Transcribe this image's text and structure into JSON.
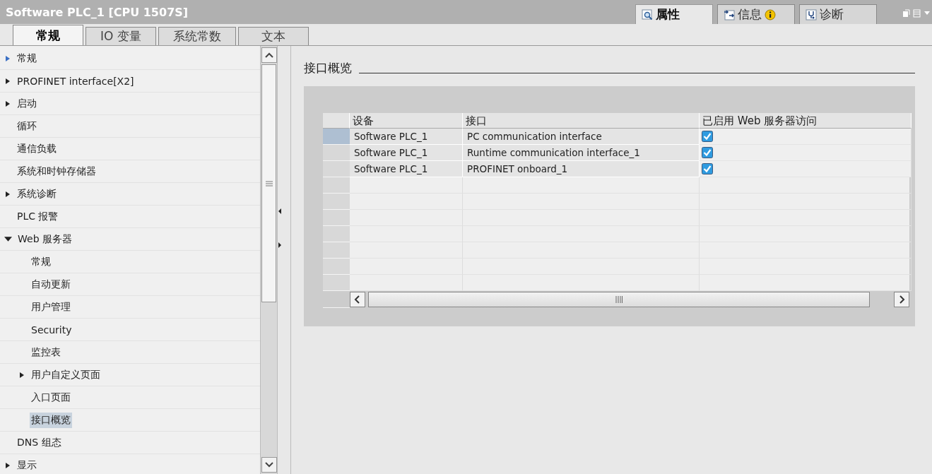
{
  "window": {
    "title": "Software PLC_1 [CPU 1507S]"
  },
  "inspector_tabs": [
    {
      "label": "属性",
      "selected": true,
      "badge": false
    },
    {
      "label": "信息",
      "selected": false,
      "badge": true
    },
    {
      "label": "诊断",
      "selected": false,
      "badge": false
    }
  ],
  "tabs": [
    {
      "label": "常规",
      "selected": true
    },
    {
      "label": "IO 变量",
      "selected": false
    },
    {
      "label": "系统常数",
      "selected": false
    },
    {
      "label": "文本",
      "selected": false
    }
  ],
  "tree": [
    {
      "label": "常规",
      "kind": "folder",
      "expanded": false,
      "selected": false
    },
    {
      "label": "PROFINET interface[X2]",
      "kind": "folder",
      "expanded": false,
      "selected": false
    },
    {
      "label": "启动",
      "kind": "folder",
      "expanded": false,
      "selected": false
    },
    {
      "label": "循环",
      "kind": "leaf",
      "selected": false
    },
    {
      "label": "通信负载",
      "kind": "leaf",
      "selected": false
    },
    {
      "label": "系统和时钟存储器",
      "kind": "leaf",
      "selected": false
    },
    {
      "label": "系统诊断",
      "kind": "folder",
      "expanded": false,
      "selected": false
    },
    {
      "label": "PLC 报警",
      "kind": "leaf",
      "selected": false
    },
    {
      "label": "Web 服务器",
      "kind": "folder",
      "expanded": true,
      "selected": false,
      "children": [
        {
          "label": "常规",
          "kind": "leaf",
          "selected": false
        },
        {
          "label": "自动更新",
          "kind": "leaf",
          "selected": false
        },
        {
          "label": "用户管理",
          "kind": "leaf",
          "selected": false
        },
        {
          "label": "Security",
          "kind": "leaf",
          "selected": false
        },
        {
          "label": "监控表",
          "kind": "leaf",
          "selected": false
        },
        {
          "label": "用户自定义页面",
          "kind": "folder",
          "expanded": false,
          "selected": false
        },
        {
          "label": "入口页面",
          "kind": "leaf",
          "selected": false
        },
        {
          "label": "接口概览",
          "kind": "leaf",
          "selected": true
        }
      ]
    },
    {
      "label": "DNS 组态",
      "kind": "leaf",
      "selected": false
    },
    {
      "label": "显示",
      "kind": "folder",
      "expanded": false,
      "selected": false
    }
  ],
  "section": {
    "title": "接口概览"
  },
  "table": {
    "columns": [
      "设备",
      "接口",
      "已启用 Web 服务器访问"
    ],
    "rows": [
      {
        "device": "Software PLC_1",
        "interface": "PC communication interface",
        "checked": true,
        "selected": true
      },
      {
        "device": "Software PLC_1",
        "interface": "Runtime communication interface_1",
        "checked": true,
        "selected": false
      },
      {
        "device": "Software PLC_1",
        "interface": "PROFINET onboard_1",
        "checked": true,
        "selected": false
      }
    ]
  }
}
